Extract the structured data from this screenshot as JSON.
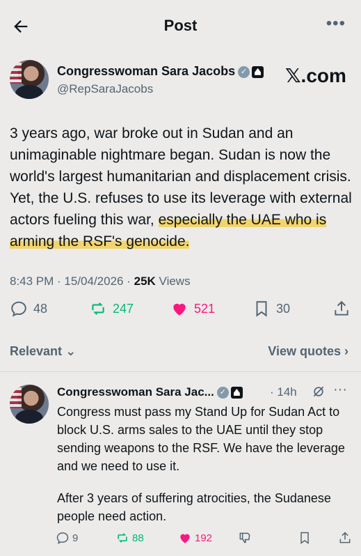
{
  "header": {
    "title": "Post"
  },
  "post": {
    "author_name": "Congresswoman Sara Jacobs",
    "handle": "@RepSaraJacobs",
    "watermark": "𝕏.com",
    "text_plain": "3 years ago, war broke out in Sudan and an unimaginable nightmare began. Sudan is now the world's largest humanitarian and displacement crisis. Yet, the U.S. refuses to use its leverage with external actors fueling this war, ",
    "text_highlighted": "especially the UAE who is arming the RSF's genocide.",
    "time": "8:43 PM",
    "date": "15/04/2026",
    "views_count": "25K",
    "views_label": "Views",
    "replies": "48",
    "reposts": "247",
    "likes": "521",
    "bookmarks": "30"
  },
  "filter": {
    "label": "Relevant",
    "view_quotes": "View quotes"
  },
  "reply": {
    "author_name": "Congresswoman Sara Jac...",
    "time": "14h",
    "text_1": "Congress must pass my Stand Up for Sudan Act to block U.S. arms sales to the UAE until they stop sending weapons to the RSF. We have the leverage and we need to use it.",
    "text_2": "After 3 years of suffering atrocities, the Sudanese people need action.",
    "replies": "9",
    "reposts": "88",
    "likes": "192"
  },
  "colors": {
    "background": "#ecebe9",
    "repost_green": "#00ba7c",
    "like_pink": "#f91880",
    "muted": "#536471",
    "highlight": "#f4c828"
  }
}
